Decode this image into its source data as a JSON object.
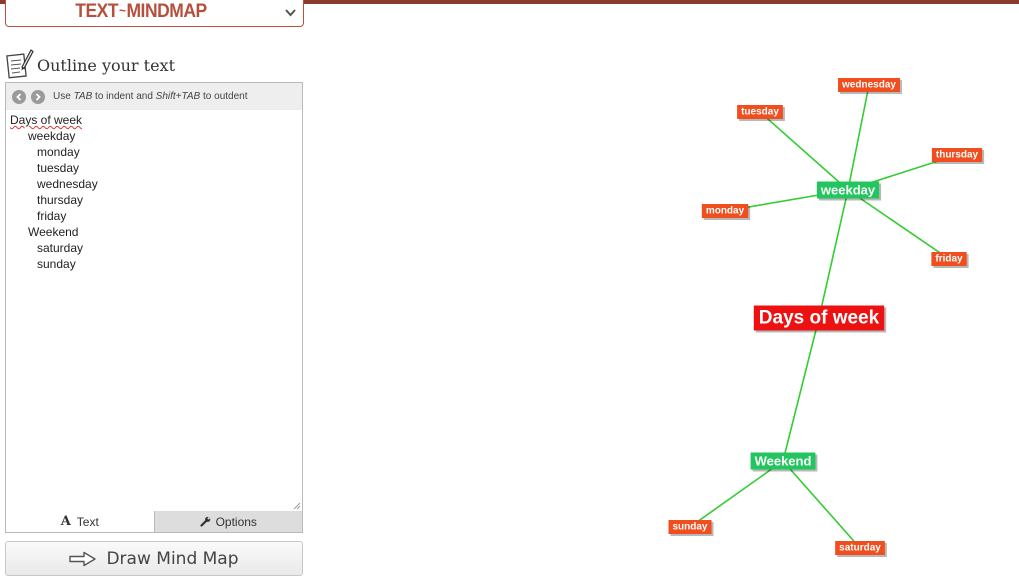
{
  "app": {
    "logo_left": "TEXT",
    "logo_tilde": "~",
    "logo_right": "MINDMAP"
  },
  "outline": {
    "title": "Outline your text",
    "hint_pre": "Use ",
    "hint_tab": "TAB",
    "hint_mid": " to indent and ",
    "hint_shift": "Shift+TAB",
    "hint_post": " to outdent",
    "lines": [
      "Days of week",
      "weekday",
      "monday",
      "tuesday",
      "wednesday",
      "thursday",
      "friday",
      "Weekend",
      "saturday",
      "sunday"
    ]
  },
  "tabs": {
    "text_label": "Text",
    "options_label": "Options"
  },
  "draw_button": {
    "label": "Draw Mind Map"
  },
  "colors": {
    "root": "#ee1111",
    "branch": "#22c55e",
    "leaf": "#f04e1e",
    "line": "#33cc33",
    "accent": "#b6503c"
  },
  "mindmap": {
    "root": "Days of week",
    "branches": [
      {
        "label": "weekday",
        "children": [
          "monday",
          "tuesday",
          "wednesday",
          "thursday",
          "friday"
        ]
      },
      {
        "label": "Weekend",
        "children": [
          "saturday",
          "sunday"
        ]
      }
    ]
  }
}
